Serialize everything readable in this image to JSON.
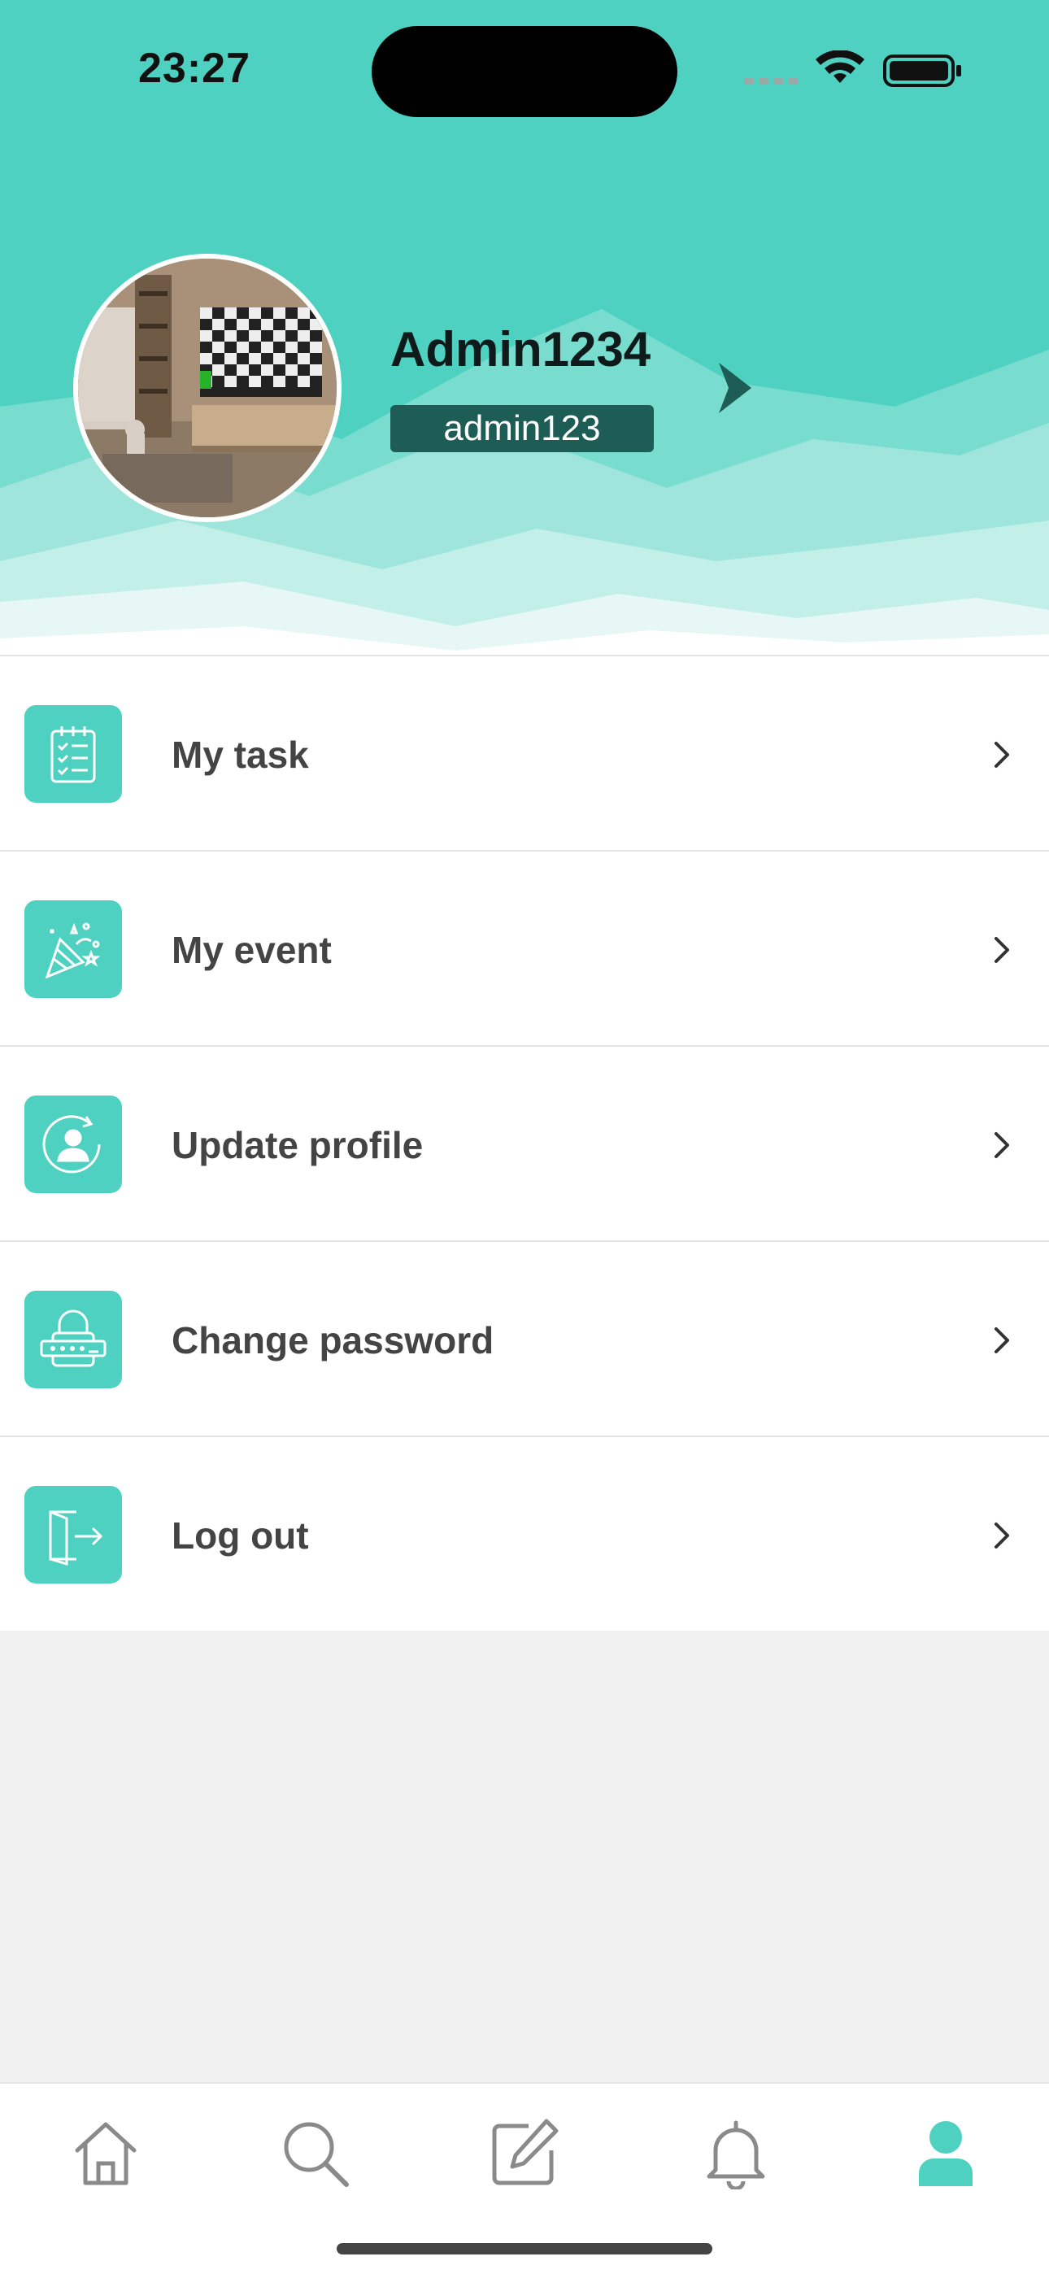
{
  "status_bar": {
    "time": "23:27"
  },
  "profile": {
    "name": "Admin1234",
    "username": "admin123",
    "avatar_icon": "living-room-photo"
  },
  "menu": [
    {
      "label": "My task",
      "icon": "task-checklist-icon"
    },
    {
      "label": "My event",
      "icon": "party-popper-icon"
    },
    {
      "label": "Update profile",
      "icon": "user-refresh-icon"
    },
    {
      "label": "Change password",
      "icon": "password-lock-icon"
    },
    {
      "label": "Log out",
      "icon": "logout-door-icon"
    }
  ],
  "tabbar": [
    {
      "name": "home",
      "icon": "home-icon",
      "active": false
    },
    {
      "name": "search",
      "icon": "search-icon",
      "active": false
    },
    {
      "name": "edit",
      "icon": "edit-icon",
      "active": false
    },
    {
      "name": "notifications",
      "icon": "bell-icon",
      "active": false
    },
    {
      "name": "profile",
      "icon": "profile-icon",
      "active": true
    }
  ],
  "colors": {
    "accent": "#4fd1c1",
    "badge": "#1e5c56",
    "background": "#f1f1f1",
    "inactive_icon": "#8a8a8a"
  }
}
